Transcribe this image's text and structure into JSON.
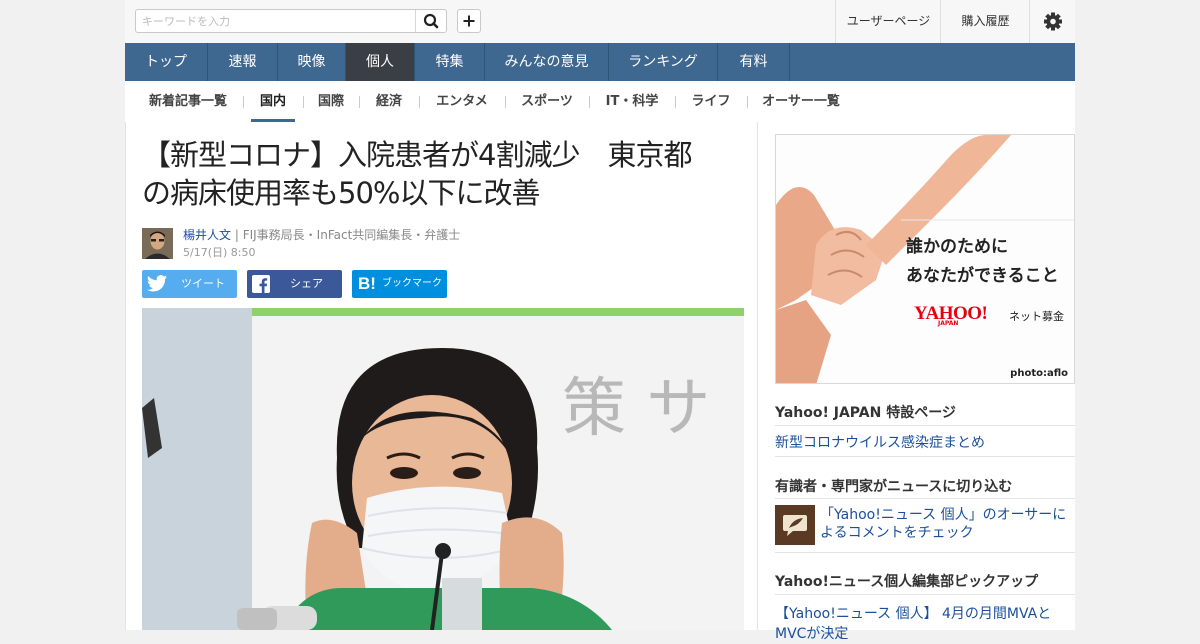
{
  "header": {
    "search_placeholder": "キーワードを入力",
    "user_page": "ユーザーページ",
    "history": "購入履歴"
  },
  "gnav": [
    "トップ",
    "速報",
    "映像",
    "個人",
    "特集",
    "みんなの意見",
    "ランキング",
    "有料"
  ],
  "gnav_active": "個人",
  "subnav": [
    "新着記事一覧",
    "国内",
    "国際",
    "経済",
    "エンタメ",
    "スポーツ",
    "IT・科学",
    "ライフ",
    "オーサー一覧"
  ],
  "subnav_active": "国内",
  "article": {
    "title_line1": "【新型コロナ】入院患者が4割減少　東京都",
    "title_line2": "の病床使用率も50%以下に改善",
    "author_name": "楊井人文",
    "author_title": " | FIJ事務局長・InFact共同編集長・弁護士",
    "date": "5/17(日) 8:50",
    "share_tweet": "ツイート",
    "share_facebook": "シェア",
    "share_bookmark": "ブックマーク",
    "photo_sign_text": "策 サ"
  },
  "sidebar": {
    "ad_line1": "誰かのために",
    "ad_line2": "あなたができること",
    "ad_logo": "YAHOO!",
    "ad_logo_sub": "JAPAN",
    "ad_service": "ネット募金",
    "ad_credit": "photo:aflo",
    "special_title": "Yahoo! JAPAN 特設ページ",
    "special_link": "新型コロナウイルス感染症まとめ",
    "expert_title": "有識者・専門家がニュースに切り込む",
    "expert_link": "「Yahoo!ニュース 個人」のオーサーによるコメントをチェック",
    "pickup_title": "Yahoo!ニュース個人編集部ピックアップ",
    "pickup_link": "【Yahoo!ニュース 個人】 4月の月間MVAとMVCが決定"
  },
  "colors": {
    "nav_bg": "#3f6890",
    "nav_active": "#3a3f46",
    "link": "#1a4f9b",
    "twitter": "#55acee",
    "facebook": "#3b5998",
    "hatena": "#008fde"
  }
}
